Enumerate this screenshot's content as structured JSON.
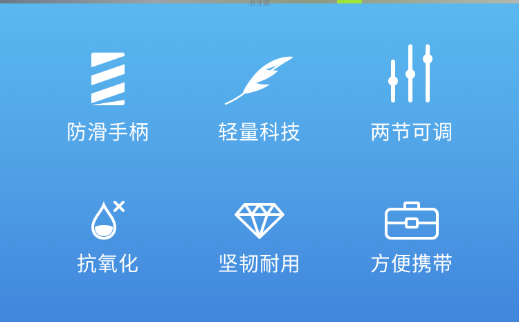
{
  "header": {
    "caption": "方寸泥"
  },
  "colors": {
    "icon": "#ffffff",
    "accent": "#9fe23a"
  },
  "features": [
    {
      "label": "防滑手柄",
      "icon": "striped-handle-icon"
    },
    {
      "label": "轻量科技",
      "icon": "feather-icon"
    },
    {
      "label": "两节可调",
      "icon": "adjust-sliders-icon"
    },
    {
      "label": "抗氧化",
      "icon": "water-drop-x-icon"
    },
    {
      "label": "坚韧耐用",
      "icon": "diamond-icon"
    },
    {
      "label": "方便携带",
      "icon": "briefcase-icon"
    }
  ]
}
